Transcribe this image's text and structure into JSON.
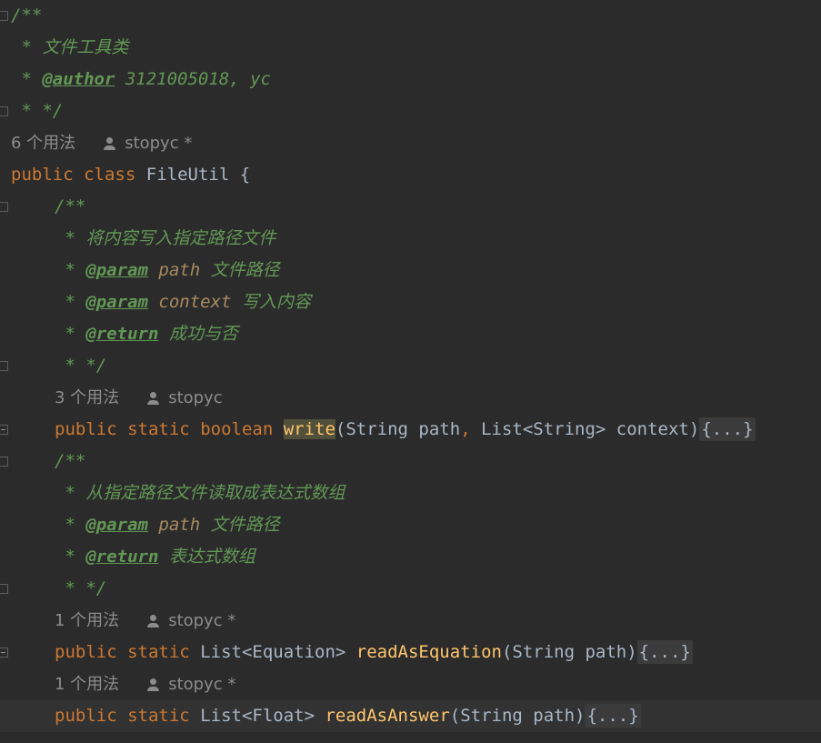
{
  "doc_comment": {
    "open": "/**",
    "desc": " * 文件工具类",
    "author_star": " * ",
    "author_tag": "@author",
    "author_value": " 3121005018, yc",
    "close": " * */"
  },
  "class_hint": {
    "usages": "6 个用法",
    "author": "stopyc *"
  },
  "class_decl": {
    "kw_public": "public",
    "kw_class": "class",
    "name": "FileUtil",
    "brace": " {"
  },
  "write_doc": {
    "open": "/**",
    "desc": " * 将内容写入指定路径文件",
    "param1_tag": "@param",
    "param1_name": "path",
    "param1_desc": " 文件路径",
    "param2_tag": "@param",
    "param2_name": "context",
    "param2_desc": " 写入内容",
    "return_tag": "@return",
    "return_desc": " 成功与否",
    "close": " * */"
  },
  "write_hint": {
    "usages": "3 个用法",
    "author": "stopyc"
  },
  "write_method": {
    "kw_public": "public",
    "kw_static": "static",
    "kw_type": "boolean",
    "name": "write",
    "params_a": "(String path",
    "comma": ",",
    "params_b": " List<String> context)",
    "folded": "{...}"
  },
  "read_doc": {
    "open": "/**",
    "desc": " * 从指定路径文件读取成表达式数组",
    "param1_tag": "@param",
    "param1_name": "path",
    "param1_desc": " 文件路径",
    "return_tag": "@return",
    "return_desc": " 表达式数组",
    "close": " * */"
  },
  "read_eq_hint": {
    "usages": "1 个用法",
    "author": "stopyc *"
  },
  "read_eq_method": {
    "kw_public": "public",
    "kw_static": "static",
    "type": "List<Equation>",
    "name": "readAsEquation",
    "params": "(String path)",
    "folded": "{...}"
  },
  "read_ans_hint": {
    "usages": "1 个用法",
    "author": "stopyc *"
  },
  "read_ans_method": {
    "kw_public": "public",
    "kw_static": "static",
    "type": "List<Float>",
    "name": "readAsAnswer",
    "params": "(String path)",
    "folded": "{...}"
  },
  "colors": {
    "background": "#2b2b2b",
    "comment": "#629755",
    "keyword": "#cc7832",
    "function": "#ffc66d",
    "param_name": "#a88b5e",
    "text": "#a9b7c6",
    "hint": "#8c8c8c"
  }
}
